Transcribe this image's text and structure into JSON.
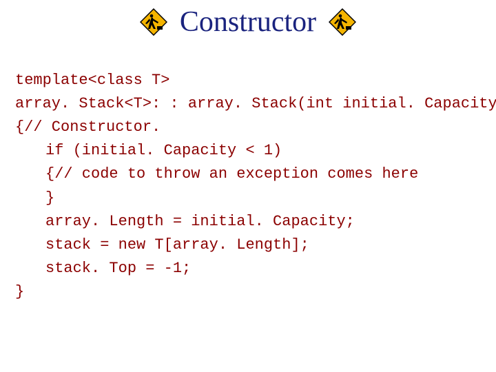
{
  "title": "Constructor",
  "icons": {
    "left": "construction-sign-icon",
    "right": "construction-sign-icon"
  },
  "code": {
    "line1": "template<class T>",
    "line2": "array. Stack<T>: : array. Stack(int initial. Capacity)",
    "line3": "{// Constructor.",
    "line4": "if (initial. Capacity < 1)",
    "line5": "{// code to throw an exception comes here",
    "line6": "}",
    "line7": "array. Length = initial. Capacity;",
    "line8": "stack = new T[array. Length];",
    "line9": "stack. Top = -1;",
    "line10": "}"
  }
}
